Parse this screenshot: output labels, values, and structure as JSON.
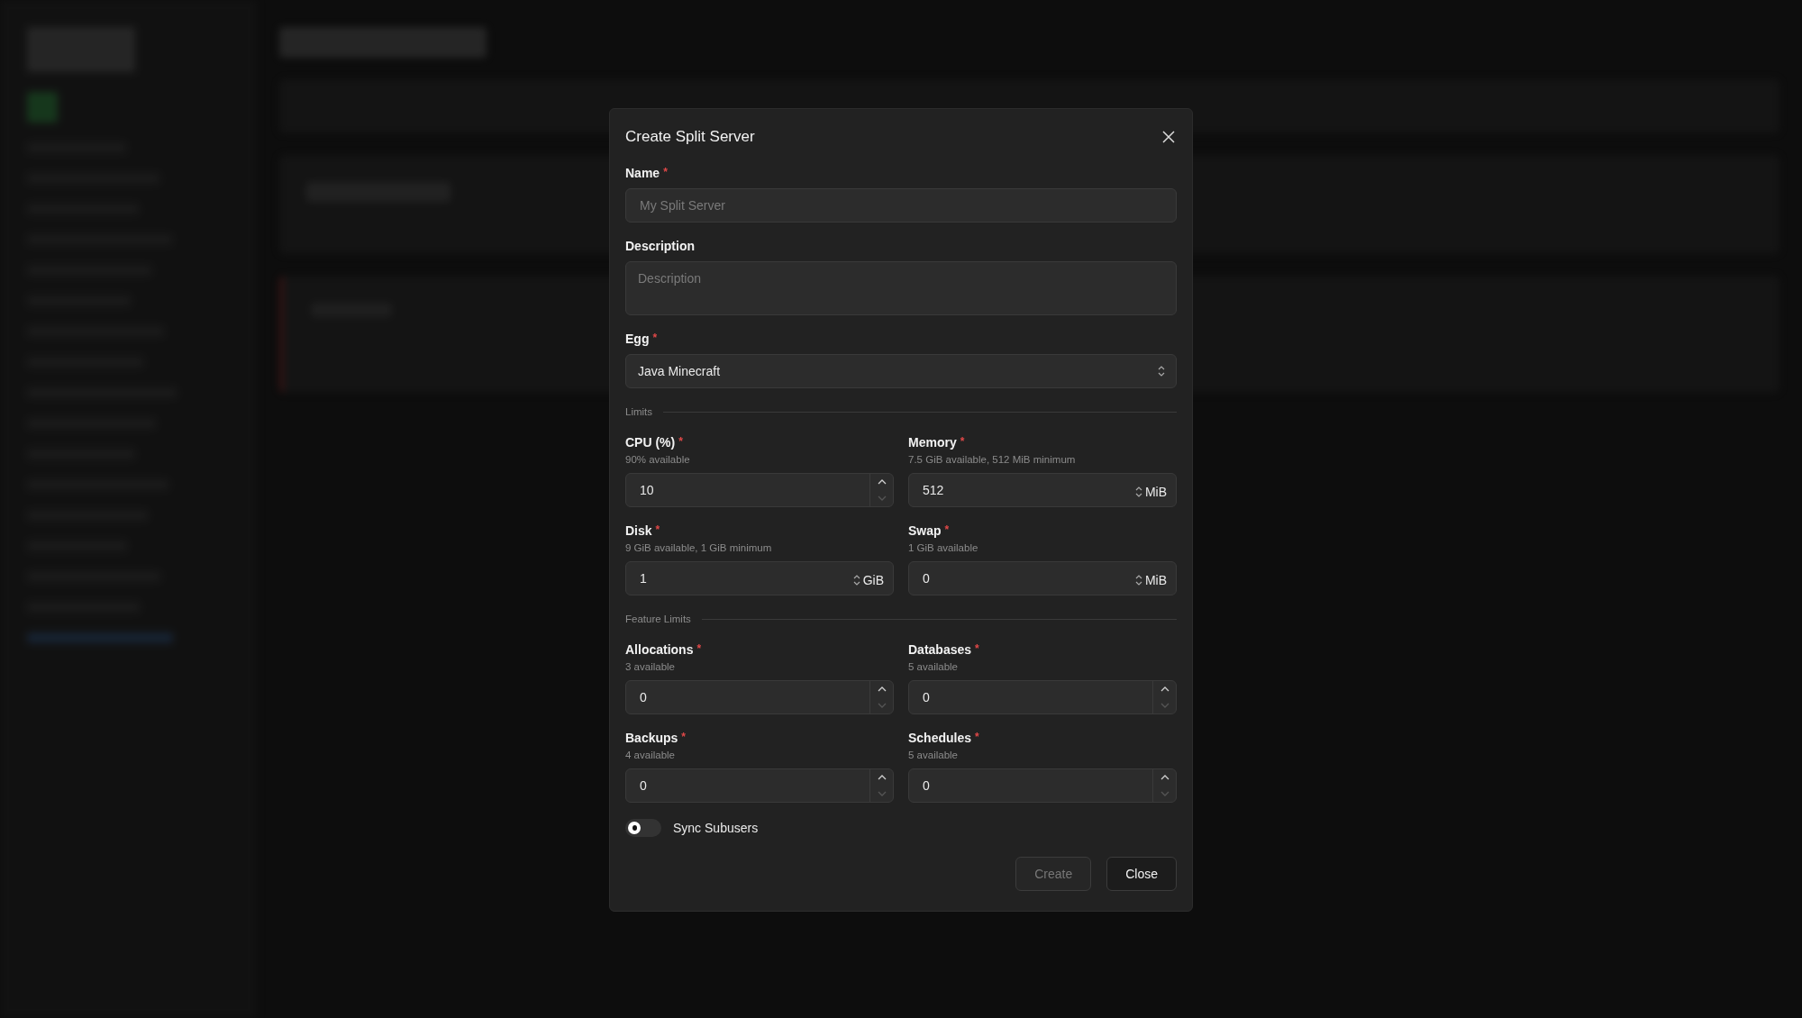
{
  "dialog": {
    "title": "Create Split Server",
    "fields": [
      {
        "kind": "text",
        "label": "Name",
        "required": "*",
        "placeholder": "My Split Server"
      },
      {
        "kind": "textarea",
        "label": "Description",
        "placeholder": "Description"
      },
      {
        "kind": "select",
        "label": "Egg",
        "required": "*",
        "value": "Java Minecraft"
      }
    ],
    "sections": [
      {
        "title": "Limits",
        "fields": [
          {
            "kind": "stepper",
            "label": "CPU (%)",
            "required": "*",
            "hint": "90% available",
            "value": "10"
          },
          {
            "kind": "unit",
            "label": "Memory",
            "required": "*",
            "hint": "7.5 GiB available, 512 MiB minimum",
            "value": "512",
            "unit": "MiB"
          },
          {
            "kind": "unit",
            "label": "Disk",
            "required": "*",
            "hint": "9 GiB available, 1 GiB minimum",
            "value": "1",
            "unit": "GiB"
          },
          {
            "kind": "unit",
            "label": "Swap",
            "required": "*",
            "hint": "1 GiB available",
            "value": "0",
            "unit": "MiB"
          }
        ]
      },
      {
        "title": "Feature Limits",
        "fields": [
          {
            "kind": "stepper",
            "label": "Allocations",
            "required": "*",
            "hint": "3 available",
            "value": "0"
          },
          {
            "kind": "stepper",
            "label": "Databases",
            "required": "*",
            "hint": "5 available",
            "value": "0"
          },
          {
            "kind": "stepper",
            "label": "Backups",
            "required": "*",
            "hint": "4 available",
            "value": "0"
          },
          {
            "kind": "stepper",
            "label": "Schedules",
            "required": "*",
            "hint": "5 available",
            "value": "0"
          }
        ]
      }
    ],
    "toggle": {
      "label": "Sync Subusers",
      "on": false
    },
    "buttons": [
      {
        "label": "Create",
        "disabled": true
      },
      {
        "label": "Close",
        "disabled": false
      }
    ]
  }
}
